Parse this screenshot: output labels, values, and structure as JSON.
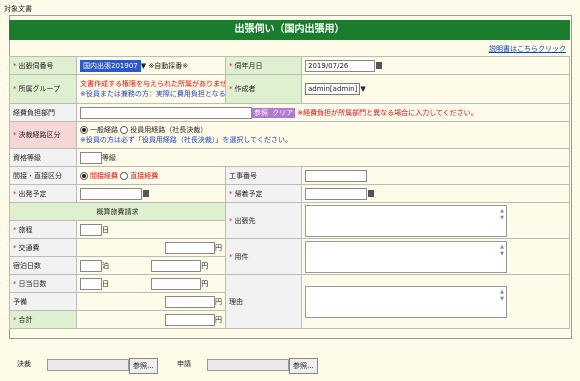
{
  "top_label": "対象文書",
  "title": "出張伺い（国内出張用）",
  "help_link": "説明書はこちらクリック",
  "fields": {
    "trip_number_label": "出張伺番号",
    "trip_number_value": "国内出張201907",
    "trip_number_auto": "※自動採番※",
    "apply_date_label": "伺年月日",
    "apply_date_value": "2019/07/26",
    "dept_group_label": "所属グループ",
    "dept_warning": "文書作成する権限を与えられた所属がありません。",
    "dept_note": "※役員または兼務の方：実際に費用負担となる部署を選択の事。",
    "creator_label": "作成者",
    "creator_value": "admin[admin]",
    "cost_dept_label": "経費負担部門",
    "cost_dept_ref": "参照",
    "cost_dept_clear": "クリア",
    "cost_dept_note": "※経費負担が所属部門と異なる場合に入力してください。",
    "approval_route_label": "決裁経路区分",
    "route_general": "一般経路",
    "route_exec": "役員用経路（社長決裁）",
    "route_note": "※役員の方は必ず「役員用経路（社長決裁）」を選択してください。",
    "grade_label": "資格等級",
    "grade_unit": "等級",
    "direct_indirect_label": "間接・直接区分",
    "indirect": "間接経費",
    "direct": "直接経費",
    "construction_no_label": "工事番号",
    "depart_label": "出発予定",
    "return_label": "帰着予定",
    "estimate_header": "概算旅費請求",
    "destination_label": "出張先",
    "business_label": "用件",
    "reason_label": "理由",
    "travel_days_label": "旅程",
    "travel_days_unit": "日",
    "transport_label": "交通費",
    "yen": "円",
    "lodging_label": "宿泊日数",
    "lodging_unit": "泊",
    "daily_label": "日当日数",
    "reserve_label": "予備",
    "total_label": "合計"
  },
  "bottom": {
    "approval_label": "決裁",
    "approval_ref": "参照...",
    "apply_label": "申請",
    "apply_ref": "参照..."
  }
}
